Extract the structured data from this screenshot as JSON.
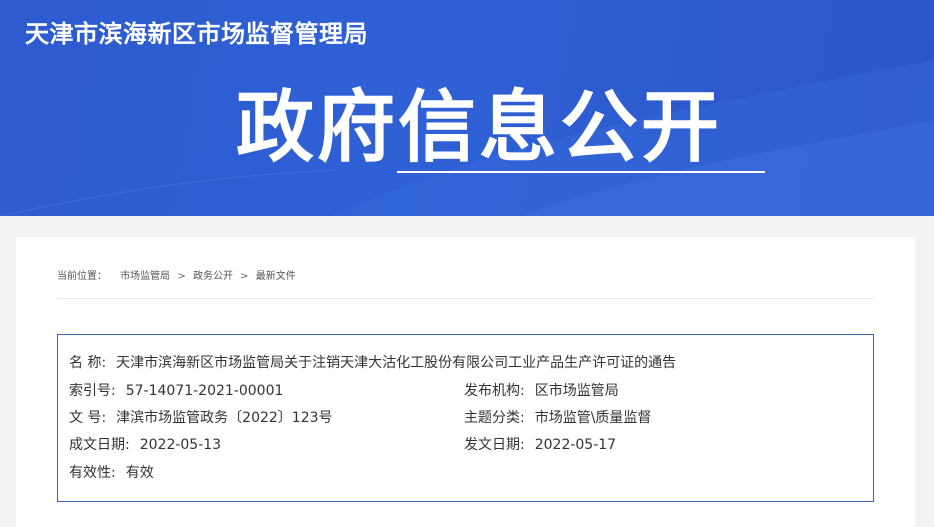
{
  "header": {
    "site_name": "天津市滨海新区市场监督管理局",
    "banner_title": "政府信息公开"
  },
  "breadcrumb": {
    "prefix": "当前位置：",
    "items": [
      "市场监管局",
      "政务公开",
      "最新文件"
    ],
    "separator": ">"
  },
  "meta": {
    "name": {
      "label": "名  称:",
      "value": "天津市滨海新区市场监管局关于注销天津大沽化工股份有限公司工业产品生产许可证的通告"
    },
    "index_no": {
      "label": "索引号:",
      "value": "57-14071-2021-00001"
    },
    "publisher": {
      "label": "发布机构:",
      "value": "区市场监管局"
    },
    "doc_no": {
      "label": "文  号:",
      "value": "津滨市场监管政务〔2022〕123号"
    },
    "topic": {
      "label": "主题分类:",
      "value": "市场监管\\质量监督"
    },
    "created_date": {
      "label": "成文日期:",
      "value": "2022-05-13"
    },
    "issued_date": {
      "label": "发文日期:",
      "value": "2022-05-17"
    },
    "validity": {
      "label": "有效性:",
      "value": "有效"
    }
  },
  "colors": {
    "banner_blue": "#2f60d6",
    "box_border": "#3f63b8"
  }
}
